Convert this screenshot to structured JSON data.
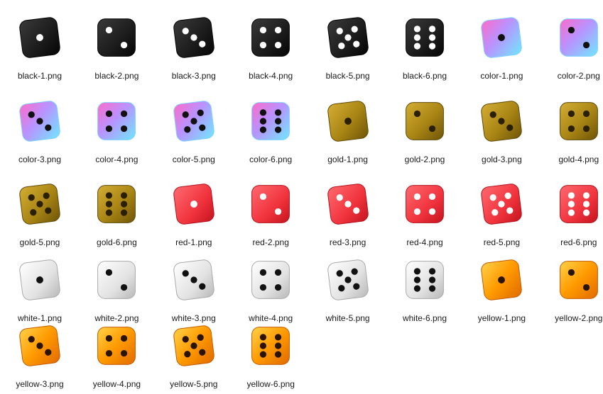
{
  "files": [
    {
      "name": "black-1.png",
      "style": "black",
      "pips": 1
    },
    {
      "name": "black-2.png",
      "style": "black",
      "pips": 2
    },
    {
      "name": "black-3.png",
      "style": "black",
      "pips": 3
    },
    {
      "name": "black-4.png",
      "style": "black",
      "pips": 4
    },
    {
      "name": "black-5.png",
      "style": "black",
      "pips": 5
    },
    {
      "name": "black-6.png",
      "style": "black",
      "pips": 6
    },
    {
      "name": "color-1.png",
      "style": "color",
      "pips": 1
    },
    {
      "name": "color-2.png",
      "style": "color",
      "pips": 2
    },
    {
      "name": "color-3.png",
      "style": "color",
      "pips": 3
    },
    {
      "name": "color-4.png",
      "style": "color",
      "pips": 4
    },
    {
      "name": "color-5.png",
      "style": "color",
      "pips": 5
    },
    {
      "name": "color-6.png",
      "style": "color",
      "pips": 6
    },
    {
      "name": "gold-1.png",
      "style": "gold",
      "pips": 1
    },
    {
      "name": "gold-2.png",
      "style": "gold",
      "pips": 2
    },
    {
      "name": "gold-3.png",
      "style": "gold",
      "pips": 3
    },
    {
      "name": "gold-4.png",
      "style": "gold",
      "pips": 4
    },
    {
      "name": "gold-5.png",
      "style": "gold",
      "pips": 5
    },
    {
      "name": "gold-6.png",
      "style": "gold",
      "pips": 6
    },
    {
      "name": "red-1.png",
      "style": "red",
      "pips": 1
    },
    {
      "name": "red-2.png",
      "style": "red",
      "pips": 2
    },
    {
      "name": "red-3.png",
      "style": "red",
      "pips": 3
    },
    {
      "name": "red-4.png",
      "style": "red",
      "pips": 4
    },
    {
      "name": "red-5.png",
      "style": "red",
      "pips": 5
    },
    {
      "name": "red-6.png",
      "style": "red",
      "pips": 6
    },
    {
      "name": "white-1.png",
      "style": "white",
      "pips": 1
    },
    {
      "name": "white-2.png",
      "style": "white",
      "pips": 2
    },
    {
      "name": "white-3.png",
      "style": "white",
      "pips": 3
    },
    {
      "name": "white-4.png",
      "style": "white",
      "pips": 4
    },
    {
      "name": "white-5.png",
      "style": "white",
      "pips": 5
    },
    {
      "name": "white-6.png",
      "style": "white",
      "pips": 6
    },
    {
      "name": "yellow-1.png",
      "style": "yellow",
      "pips": 1
    },
    {
      "name": "yellow-2.png",
      "style": "yellow",
      "pips": 2
    },
    {
      "name": "yellow-3.png",
      "style": "yellow",
      "pips": 3
    },
    {
      "name": "yellow-4.png",
      "style": "yellow",
      "pips": 4
    },
    {
      "name": "yellow-5.png",
      "style": "yellow",
      "pips": 5
    },
    {
      "name": "yellow-6.png",
      "style": "yellow",
      "pips": 6
    }
  ],
  "styles": {
    "black": {
      "face": "#1b1b1b",
      "pip": "#ffffff",
      "edge": "#000000"
    },
    "color": {
      "face": "#c8a8ff",
      "pip": "#111111",
      "edge": "#7fd0ff"
    },
    "gold": {
      "face": "#a88414",
      "pip": "#2a2000",
      "edge": "#5e4806"
    },
    "red": {
      "face": "#f0323c",
      "pip": "#ffffff",
      "edge": "#b0121c"
    },
    "white": {
      "face": "#e6e6e6",
      "pip": "#111111",
      "edge": "#a9a9a9"
    },
    "yellow": {
      "face": "#ff9a00",
      "pip": "#2a1400",
      "edge": "#c45a00"
    }
  }
}
